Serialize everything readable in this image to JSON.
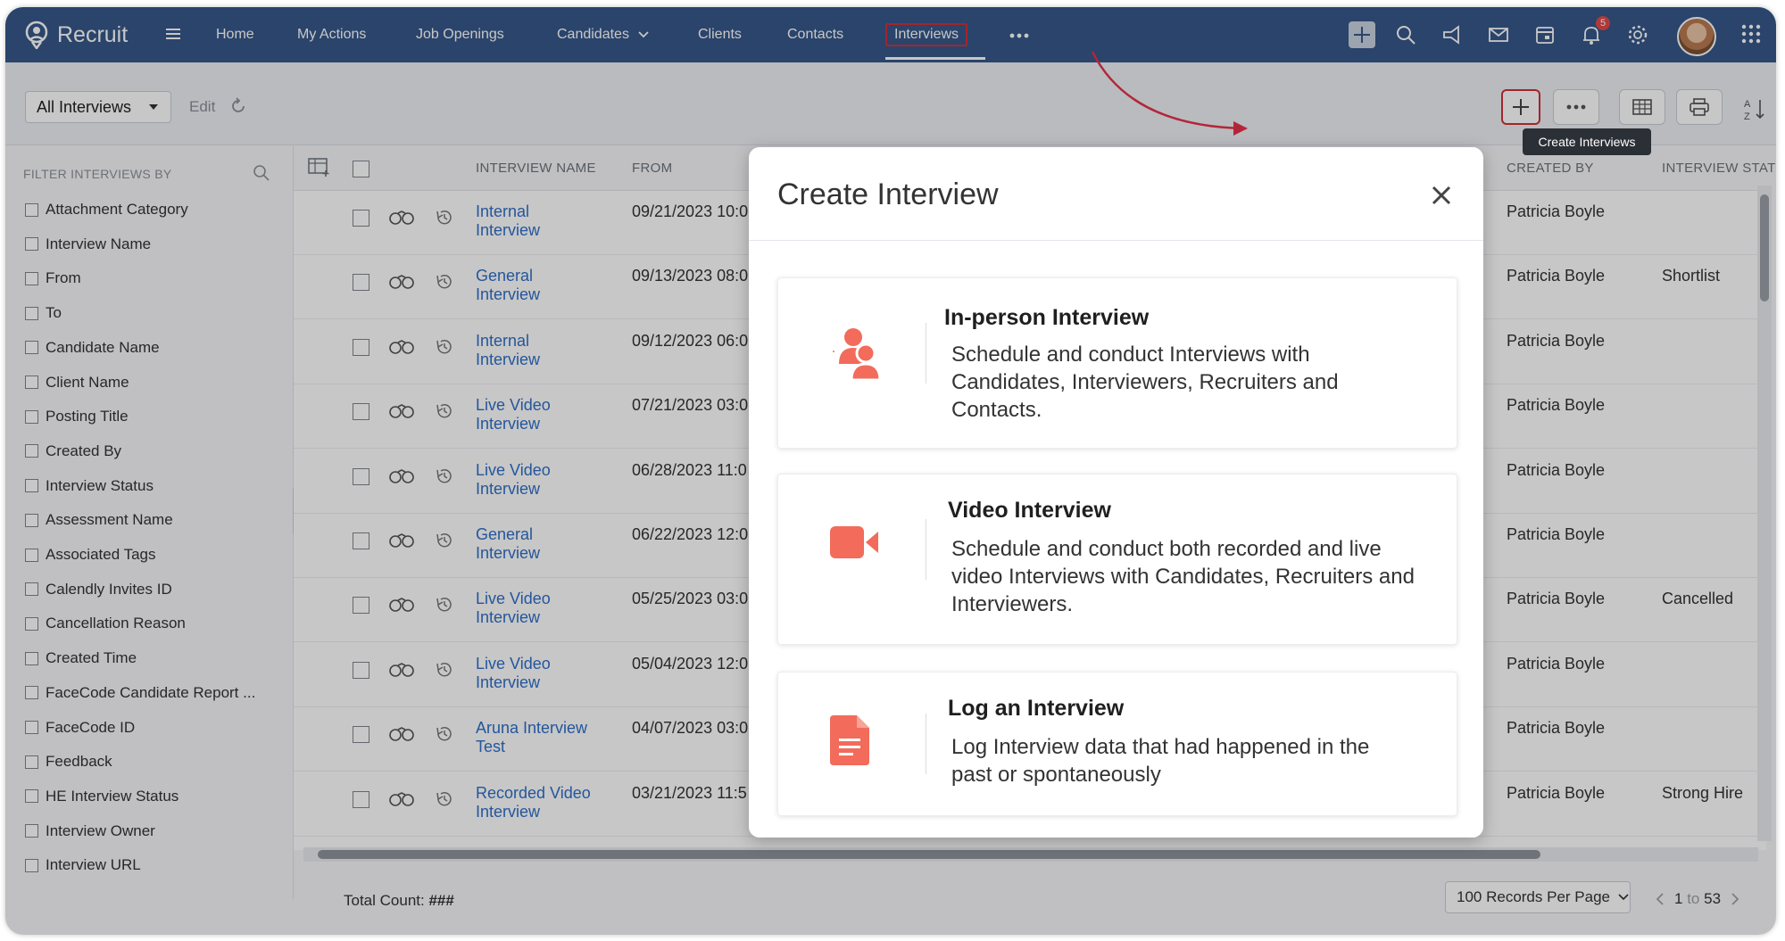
{
  "app": {
    "name": "Recruit"
  },
  "nav": {
    "items": [
      {
        "label": "Home"
      },
      {
        "label": "My Actions"
      },
      {
        "label": "Job Openings"
      },
      {
        "label": "Candidates"
      },
      {
        "label": "Clients"
      },
      {
        "label": "Contacts"
      },
      {
        "label": "Interviews"
      }
    ],
    "active": "Interviews",
    "notification_count": "5"
  },
  "toolbar": {
    "view": "All Interviews",
    "edit_label": "Edit",
    "create_tooltip": "Create Interviews"
  },
  "sidebar": {
    "title": "FILTER INTERVIEWS BY",
    "filters": [
      "Attachment Category",
      "Interview Name",
      "From",
      "To",
      "Candidate Name",
      "Client Name",
      "Posting Title",
      "Created By",
      "Interview Status",
      "Assessment Name",
      "Associated Tags",
      "Calendly Invites ID",
      "Cancellation Reason",
      "Created Time",
      "FaceCode Candidate Report ...",
      "FaceCode ID",
      "Feedback",
      "HE Interview Status",
      "Interview Owner",
      "Interview URL"
    ]
  },
  "table": {
    "headers": {
      "name": "INTERVIEW NAME",
      "from": "FROM",
      "created_by": "CREATED BY",
      "status": "INTERVIEW STATU"
    },
    "rows": [
      {
        "name": "Internal Interview",
        "from": "09/21/2023 10:0",
        "created_by": "Patricia Boyle",
        "status": ""
      },
      {
        "name": "General Interview",
        "from": "09/13/2023 08:0",
        "created_by": "Patricia Boyle",
        "status": "Shortlist"
      },
      {
        "name": "Internal Interview",
        "from": "09/12/2023 06:0",
        "created_by": "Patricia Boyle",
        "status": ""
      },
      {
        "name": "Live Video Interview",
        "from": "07/21/2023 03:0",
        "created_by": "Patricia Boyle",
        "status": ""
      },
      {
        "name": "Live Video Interview",
        "from": "06/28/2023 11:0",
        "created_by": "Patricia Boyle",
        "status": ""
      },
      {
        "name": "General Interview",
        "from": "06/22/2023 12:0",
        "created_by": "Patricia Boyle",
        "status": ""
      },
      {
        "name": "Live Video Interview",
        "from": "05/25/2023 03:0",
        "created_by": "Patricia Boyle",
        "status": "Cancelled"
      },
      {
        "name": "Live Video Interview",
        "from": "05/04/2023 12:0",
        "created_by": "Patricia Boyle",
        "status": ""
      },
      {
        "name": "Aruna Interview Test",
        "from": "04/07/2023 03:0",
        "created_by": "Patricia Boyle",
        "status": ""
      },
      {
        "name": "Recorded Video Interview",
        "from": "03/21/2023 11:5",
        "created_by": "Patricia Boyle",
        "status": "Strong Hire"
      }
    ]
  },
  "footer": {
    "total_label": "Total Count:",
    "total_value": "###",
    "per_page": "100 Records Per Page",
    "page_from": "1",
    "page_to": "to",
    "page_total": "53"
  },
  "modal": {
    "title": "Create Interview",
    "options": [
      {
        "title": "In-person Interview",
        "description": "Schedule and conduct Interviews with Candidates, Interviewers, Recruiters and Contacts.",
        "icon": "people-icon"
      },
      {
        "title": "Video Interview",
        "description": "Schedule and conduct both recorded and live video Interviews with Candidates, Recruiters and Interviewers.",
        "icon": "video-camera-icon"
      },
      {
        "title": "Log an Interview",
        "description": "Log Interview data that had happened in the past or spontaneously",
        "icon": "document-icon"
      }
    ]
  },
  "colors": {
    "topbar": "#37588a",
    "accent_red": "#d0303a",
    "icon_coral": "#f26b5b",
    "link": "#2f6fc8"
  }
}
